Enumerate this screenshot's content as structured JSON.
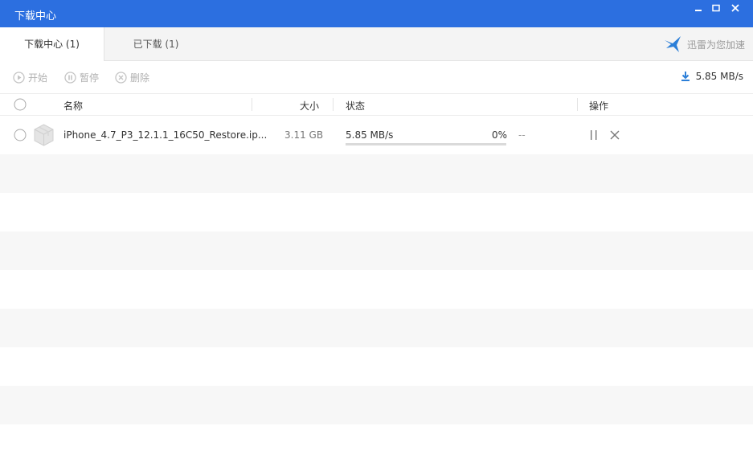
{
  "window": {
    "title": "下载中心"
  },
  "tabs": [
    {
      "label": "下载中心 (1)",
      "active": true
    },
    {
      "label": "已下载 (1)",
      "active": false
    }
  ],
  "brand": {
    "text": "迅雷为您加速",
    "icon": "thunder-bird-icon"
  },
  "toolbar": {
    "start_label": "开始",
    "pause_label": "暂停",
    "delete_label": "删除",
    "total_speed": "5.85 MB/s"
  },
  "columns": {
    "name": "名称",
    "size": "大小",
    "status": "状态",
    "actions": "操作"
  },
  "downloads": [
    {
      "file_name": "iPhone_4.7_P3_12.1.1_16C50_Restore.ip...",
      "size": "3.11 GB",
      "speed": "5.85 MB/s",
      "percent_label": "0%",
      "progress": 0,
      "eta": "--"
    }
  ],
  "colors": {
    "titlebar": "#2c6fe0",
    "accent": "#3b8ae6"
  }
}
